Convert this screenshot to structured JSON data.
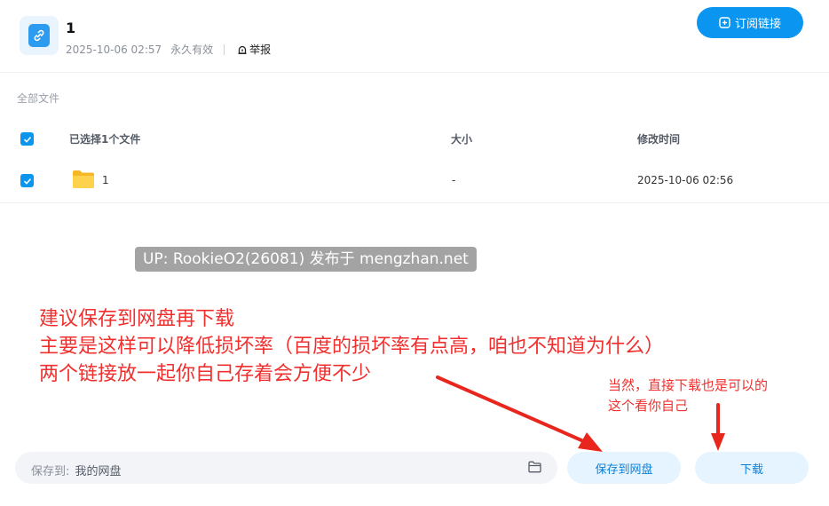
{
  "header": {
    "title": "1",
    "date": "2025-10-06 02:57",
    "expiry": "永久有效",
    "report_label": "举报",
    "subscribe_label": "订阅链接"
  },
  "breadcrumb": "全部文件",
  "table": {
    "columns": [
      "已选择1个文件",
      "大小",
      "修改时间"
    ],
    "rows": [
      {
        "name": "1",
        "size": "-",
        "modified": "2025-10-06 02:56",
        "checked": true
      }
    ]
  },
  "watermark": "UP: RookieO2(26081) 发布于 mengzhan.net",
  "annotations": {
    "big_lines": [
      "建议保存到网盘再下载",
      "主要是这样可以降低损坏率（百度的损坏率有点高，咱也不知道为什么）",
      "两个链接放一起你自己存着会方便不少"
    ],
    "small_lines": [
      "当然，直接下载也是可以的",
      "这个看你自己"
    ]
  },
  "footer": {
    "save_to_label": "保存到:",
    "save_to_path": "我的网盘",
    "save_button": "保存到网盘",
    "download_button": "下载"
  },
  "colors": {
    "accent": "#0a96f0",
    "annotation": "#f0302e",
    "pill_bg": "#e6f4ff"
  }
}
